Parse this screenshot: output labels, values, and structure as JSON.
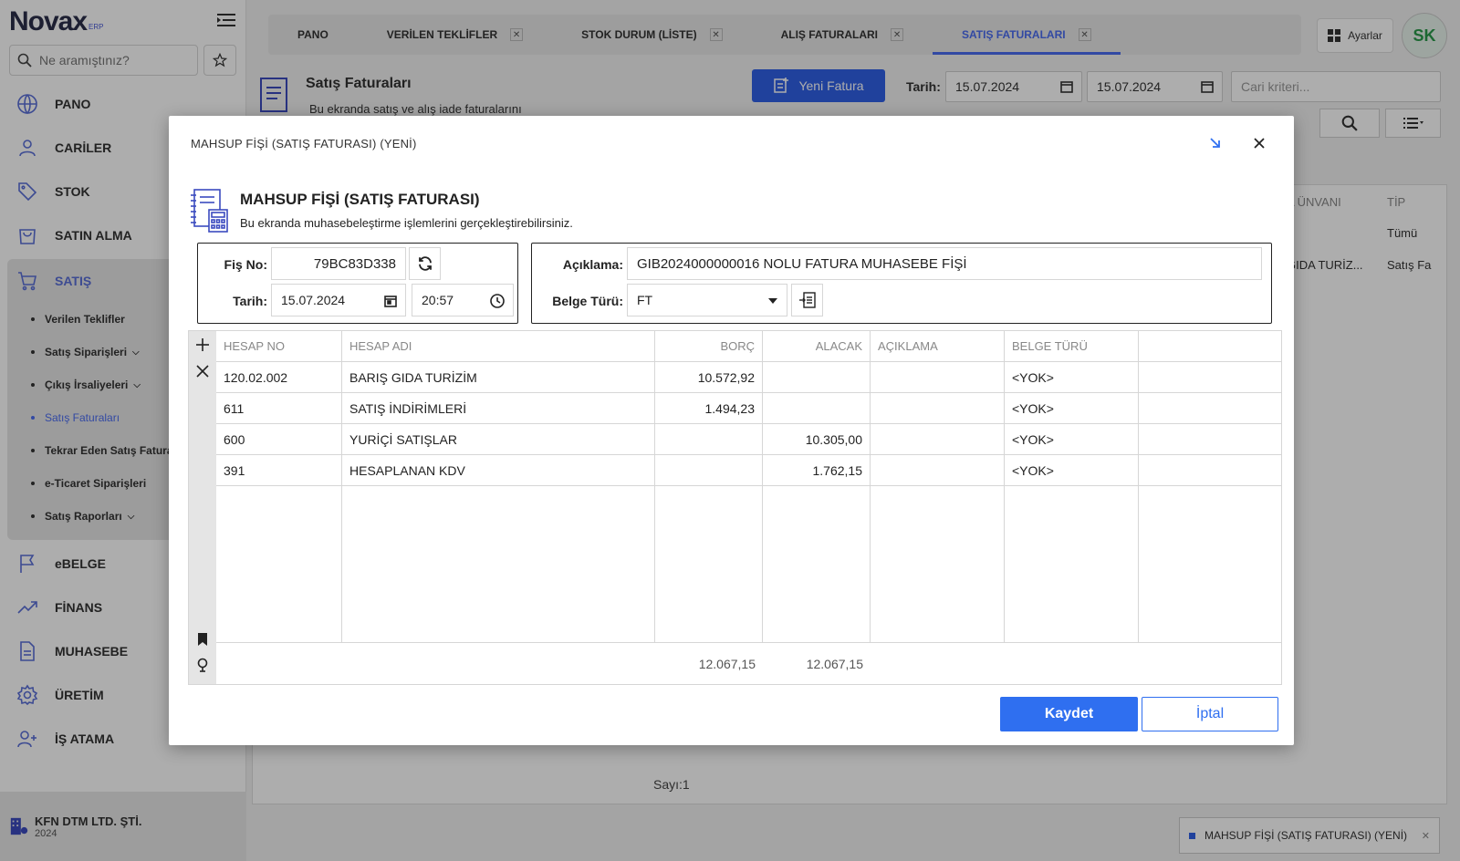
{
  "app": {
    "logo_text": "Novax",
    "logo_sub": "ERP"
  },
  "sidebar": {
    "search_placeholder": "Ne aramıştınız?",
    "items": [
      {
        "label": "PANO",
        "icon": "globe-icon"
      },
      {
        "label": "CARİLER",
        "icon": "user-icon"
      },
      {
        "label": "STOK",
        "icon": "tag-icon"
      },
      {
        "label": "SATIN ALMA",
        "icon": "bag-icon"
      },
      {
        "label": "SATIŞ",
        "icon": "cart-icon"
      },
      {
        "label": "eBELGE",
        "icon": "flag-icon"
      },
      {
        "label": "FİNANS",
        "icon": "trend-icon"
      },
      {
        "label": "MUHASEBE",
        "icon": "document-icon"
      },
      {
        "label": "ÜRETİM",
        "icon": "gear-icon"
      },
      {
        "label": "İŞ ATAMA",
        "icon": "user-plus-icon"
      }
    ],
    "sales_sub": [
      {
        "label": "Verilen Teklifler",
        "chevron": false
      },
      {
        "label": "Satış Siparişleri",
        "chevron": true
      },
      {
        "label": "Çıkış İrsaliyeleri",
        "chevron": true
      },
      {
        "label": "Satış Faturaları",
        "chevron": false,
        "active": true
      },
      {
        "label": "Tekrar Eden Satış Faturaları",
        "chevron": false
      },
      {
        "label": "e-Ticaret Siparişleri",
        "chevron": false
      },
      {
        "label": "Satış Raporları",
        "chevron": true
      }
    ],
    "company": {
      "name": "KFN DTM LTD. ŞTİ.",
      "year": "2024"
    }
  },
  "topbar": {
    "tabs": [
      {
        "label": "PANO",
        "closable": false
      },
      {
        "label": "VERİLEN TEKLİFLER",
        "closable": true
      },
      {
        "label": "STOK DURUM (LİSTE)",
        "closable": true
      },
      {
        "label": "ALIŞ FATURALARI",
        "closable": true
      },
      {
        "label": "SATIŞ FATURALARI",
        "closable": true,
        "active": true
      }
    ],
    "settings_label": "Ayarlar",
    "avatar_initials": "SK"
  },
  "page": {
    "title": "Satış Faturaları",
    "subtitle": "Bu ekranda satış ve alış iade faturalarını",
    "new_button": "Yeni Fatura",
    "date_label": "Tarih:",
    "date_from": "15.07.2024",
    "date_to": "15.07.2024",
    "cari_placeholder": "Cari kriteri...",
    "bg_headers": {
      "title": "A ÜNVANI",
      "type": "TİP",
      "type_filter": "Tümü",
      "row_name": "GIDA TURİZ...",
      "row_type": "Satış Fa"
    },
    "count": "Sayı:1"
  },
  "modal": {
    "title": "MAHSUP FİŞİ (SATIŞ FATURASI) (YENİ)",
    "form_title": "MAHSUP FİŞİ (SATIŞ FATURASI)",
    "form_subtitle": "Bu ekranda muhasebeleştirme işlemlerini gerçekleştirebilirsiniz.",
    "fis_no_label": "Fiş No:",
    "fis_no": "79BC83D338",
    "tarih_label": "Tarih:",
    "tarih": "15.07.2024",
    "saat": "20:57",
    "aciklama_label": "Açıklama:",
    "aciklama": "GIB2024000000016 NOLU FATURA MUHASEBE FİŞİ",
    "belge_turu_label": "Belge Türü:",
    "belge_turu": "FT",
    "grid": {
      "columns": [
        "HESAP NO",
        "HESAP ADI",
        "BORÇ",
        "ALACAK",
        "AÇIKLAMA",
        "BELGE TÜRÜ",
        ""
      ],
      "rows": [
        {
          "hesap_no": "120.02.002",
          "hesap_adi": "BARIŞ GIDA TURİZİM",
          "borc": "10.572,92",
          "alacak": "",
          "aciklama": "",
          "belge_turu": "<YOK>"
        },
        {
          "hesap_no": "611",
          "hesap_adi": "SATIŞ İNDİRİMLERİ",
          "borc": "1.494,23",
          "alacak": "",
          "aciklama": "",
          "belge_turu": "<YOK>"
        },
        {
          "hesap_no": "600",
          "hesap_adi": "YURİÇİ SATIŞLAR",
          "borc": "",
          "alacak": "10.305,00",
          "aciklama": "",
          "belge_turu": "<YOK>"
        },
        {
          "hesap_no": "391",
          "hesap_adi": "HESAPLANAN KDV",
          "borc": "",
          "alacak": "1.762,15",
          "aciklama": "",
          "belge_turu": "<YOK>"
        }
      ],
      "total_borc": "12.067,15",
      "total_alacak": "12.067,15"
    },
    "save_label": "Kaydet",
    "cancel_label": "İptal"
  },
  "taskbar": {
    "label": "MAHSUP FİŞİ (SATIŞ FATURASI) (YENİ)"
  },
  "colors": {
    "accent": "#2f6ff0",
    "brand_dark": "#2b2f4a",
    "sidebar_active": "#5a6fd8"
  }
}
